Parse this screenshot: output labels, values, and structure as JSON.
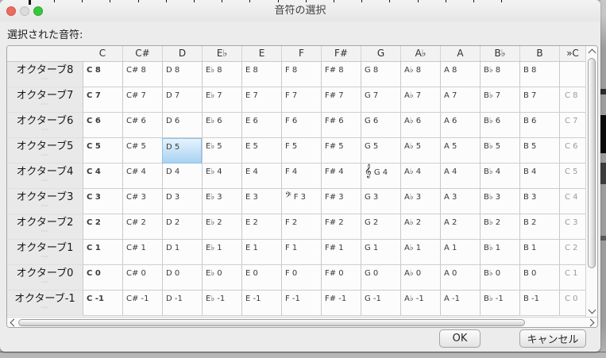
{
  "window": {
    "title": "音符の選択",
    "traffic_lights": {
      "close": "#ee6a5f",
      "minimize": "#dcdcdc",
      "zoom": "#37c83c"
    }
  },
  "selected_note_label": "選択された音符:",
  "table": {
    "columns": [
      "C",
      "C#",
      "D",
      "E♭",
      "E",
      "F",
      "F#",
      "G",
      "A♭",
      "A",
      "B♭",
      "B"
    ],
    "extra_column_header": "»C",
    "row_handle_dots": "⋯",
    "rows": [
      {
        "label": "オクターブ8",
        "cells": [
          "C 8",
          "C# 8",
          "D 8",
          "E♭ 8",
          "E 8",
          "F 8",
          "F# 8",
          "G 8",
          "A♭ 8",
          "A 8",
          "B♭ 8",
          "B 8"
        ],
        "next_c": ""
      },
      {
        "label": "オクターブ7",
        "cells": [
          "C 7",
          "C# 7",
          "D 7",
          "E♭ 7",
          "E 7",
          "F 7",
          "F# 7",
          "G 7",
          "A♭ 7",
          "A 7",
          "B♭ 7",
          "B 7"
        ],
        "next_c": "C 8"
      },
      {
        "label": "オクターブ6",
        "cells": [
          "C 6",
          "C# 6",
          "D 6",
          "E♭ 6",
          "E 6",
          "F 6",
          "F# 6",
          "G 6",
          "A♭ 6",
          "A 6",
          "B♭ 6",
          "B 6"
        ],
        "next_c": "C 7"
      },
      {
        "label": "オクターブ5",
        "cells": [
          "C 5",
          "C# 5",
          "D 5",
          "E♭ 5",
          "E 5",
          "F 5",
          "F# 5",
          "G 5",
          "A♭ 5",
          "A 5",
          "B♭ 5",
          "B 5"
        ],
        "next_c": "C 6"
      },
      {
        "label": "オクターブ4",
        "cells": [
          "C 4",
          "C# 4",
          "D 4",
          "E♭ 4",
          "E 4",
          "F 4",
          "F# 4",
          "G 4",
          "A♭ 4",
          "A 4",
          "B♭ 4",
          "B 4"
        ],
        "next_c": "C 5"
      },
      {
        "label": "オクターブ3",
        "cells": [
          "C 3",
          "C# 3",
          "D 3",
          "E♭ 3",
          "E 3",
          "F 3",
          "F# 3",
          "G 3",
          "A♭ 3",
          "A 3",
          "B♭ 3",
          "B 3"
        ],
        "next_c": "C 4"
      },
      {
        "label": "オクターブ2",
        "cells": [
          "C 2",
          "C# 2",
          "D 2",
          "E♭ 2",
          "E 2",
          "F 2",
          "F# 2",
          "G 2",
          "A♭ 2",
          "A 2",
          "B♭ 2",
          "B 2"
        ],
        "next_c": "C 3"
      },
      {
        "label": "オクターブ1",
        "cells": [
          "C 1",
          "C# 1",
          "D 1",
          "E♭ 1",
          "E 1",
          "F 1",
          "F# 1",
          "G 1",
          "A♭ 1",
          "A 1",
          "B♭ 1",
          "B 1"
        ],
        "next_c": "C 2"
      },
      {
        "label": "オクターブ0",
        "cells": [
          "C 0",
          "C# 0",
          "D 0",
          "E♭ 0",
          "E 0",
          "F 0",
          "F# 0",
          "G 0",
          "A♭ 0",
          "A 0",
          "B♭ 0",
          "B 0"
        ],
        "next_c": "C 1"
      },
      {
        "label": "オクターブ-1",
        "cells": [
          "C -1",
          "C# -1",
          "D -1",
          "E♭ -1",
          "E -1",
          "F -1",
          "F# -1",
          "G -1",
          "A♭ -1",
          "A -1",
          "B♭ -1",
          "B -1"
        ],
        "next_c": "C 0"
      }
    ],
    "selected_cell": "D 5",
    "treble_clef_cell": "G 4",
    "bass_clef_cell": "F 3",
    "treble_clef_icon": "𝄞",
    "bass_clef_icon": "𝄢"
  },
  "buttons": {
    "ok": "OK",
    "cancel": "キャンセル"
  },
  "colors": {
    "selection_top": "#e6f3fd",
    "selection_bottom": "#a9d2f1",
    "selection_border": "#8fc0e6"
  }
}
